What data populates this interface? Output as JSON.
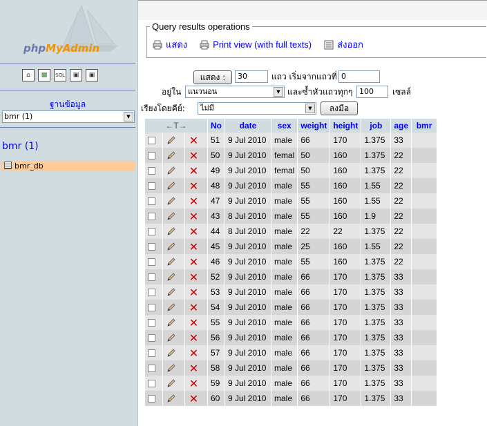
{
  "left": {
    "logo_php": "php",
    "logo_myadmin": "MyAdmin",
    "icons": [
      "home-icon",
      "exit-icon",
      "sql-icon",
      "docs-icon",
      "docs2-icon"
    ],
    "db_label": "ฐานข้อมูล",
    "db_select_value": "bmr (1)",
    "db_heading": "bmr (1)",
    "table_item": "bmr_db"
  },
  "ops": {
    "legend": "Query results operations",
    "show_label": "แสดง",
    "print_label": "Print view (with full texts)",
    "export_label": "ส่งออก"
  },
  "nav": {
    "show_button": "แสดง :",
    "rows_value": "30",
    "rows_from_label": "แถว เริ่มจากแถวที่",
    "start_value": "0",
    "in_mode_label": "อยู่ใน",
    "mode_value": "แนวนอน",
    "repeat_label": "และซ้ำหัวแถวทุกๆ",
    "repeat_value": "100",
    "cells_label": "เซลล์",
    "sort_label": "เรียงโดยคีย์:",
    "sort_value": "ไม่มี",
    "go_button": "ลงมือ"
  },
  "table": {
    "arrows": "←T→",
    "columns": [
      "No",
      "date",
      "sex",
      "weight",
      "height",
      "job",
      "age",
      "bmr"
    ],
    "rows": [
      [
        "51",
        "9 Jul 2010",
        "male",
        "66",
        "170",
        "1.375",
        "33",
        ""
      ],
      [
        "50",
        "9 Jul 2010",
        "femal",
        "50",
        "160",
        "1.375",
        "22",
        ""
      ],
      [
        "49",
        "9 Jul 2010",
        "femal",
        "50",
        "160",
        "1.375",
        "22",
        ""
      ],
      [
        "48",
        "9 Jul 2010",
        "male",
        "55",
        "160",
        "1.55",
        "22",
        ""
      ],
      [
        "47",
        "9 Jul 2010",
        "male",
        "55",
        "160",
        "1.55",
        "22",
        ""
      ],
      [
        "43",
        "8 Jul 2010",
        "male",
        "55",
        "160",
        "1.9",
        "22",
        ""
      ],
      [
        "44",
        "8 Jul 2010",
        "male",
        "22",
        "22",
        "1.375",
        "22",
        ""
      ],
      [
        "45",
        "9 Jul 2010",
        "male",
        "25",
        "160",
        "1.55",
        "22",
        ""
      ],
      [
        "46",
        "9 Jul 2010",
        "male",
        "55",
        "160",
        "1.375",
        "22",
        ""
      ],
      [
        "52",
        "9 Jul 2010",
        "male",
        "66",
        "170",
        "1.375",
        "33",
        ""
      ],
      [
        "53",
        "9 Jul 2010",
        "male",
        "66",
        "170",
        "1.375",
        "33",
        ""
      ],
      [
        "54",
        "9 Jul 2010",
        "male",
        "66",
        "170",
        "1.375",
        "33",
        ""
      ],
      [
        "55",
        "9 Jul 2010",
        "male",
        "66",
        "170",
        "1.375",
        "33",
        ""
      ],
      [
        "56",
        "9 Jul 2010",
        "male",
        "66",
        "170",
        "1.375",
        "33",
        ""
      ],
      [
        "57",
        "9 Jul 2010",
        "male",
        "66",
        "170",
        "1.375",
        "33",
        ""
      ],
      [
        "58",
        "9 Jul 2010",
        "male",
        "66",
        "170",
        "1.375",
        "33",
        ""
      ],
      [
        "59",
        "9 Jul 2010",
        "male",
        "66",
        "170",
        "1.375",
        "33",
        ""
      ],
      [
        "60",
        "9 Jul 2010",
        "male",
        "66",
        "170",
        "1.375",
        "33",
        ""
      ]
    ]
  }
}
